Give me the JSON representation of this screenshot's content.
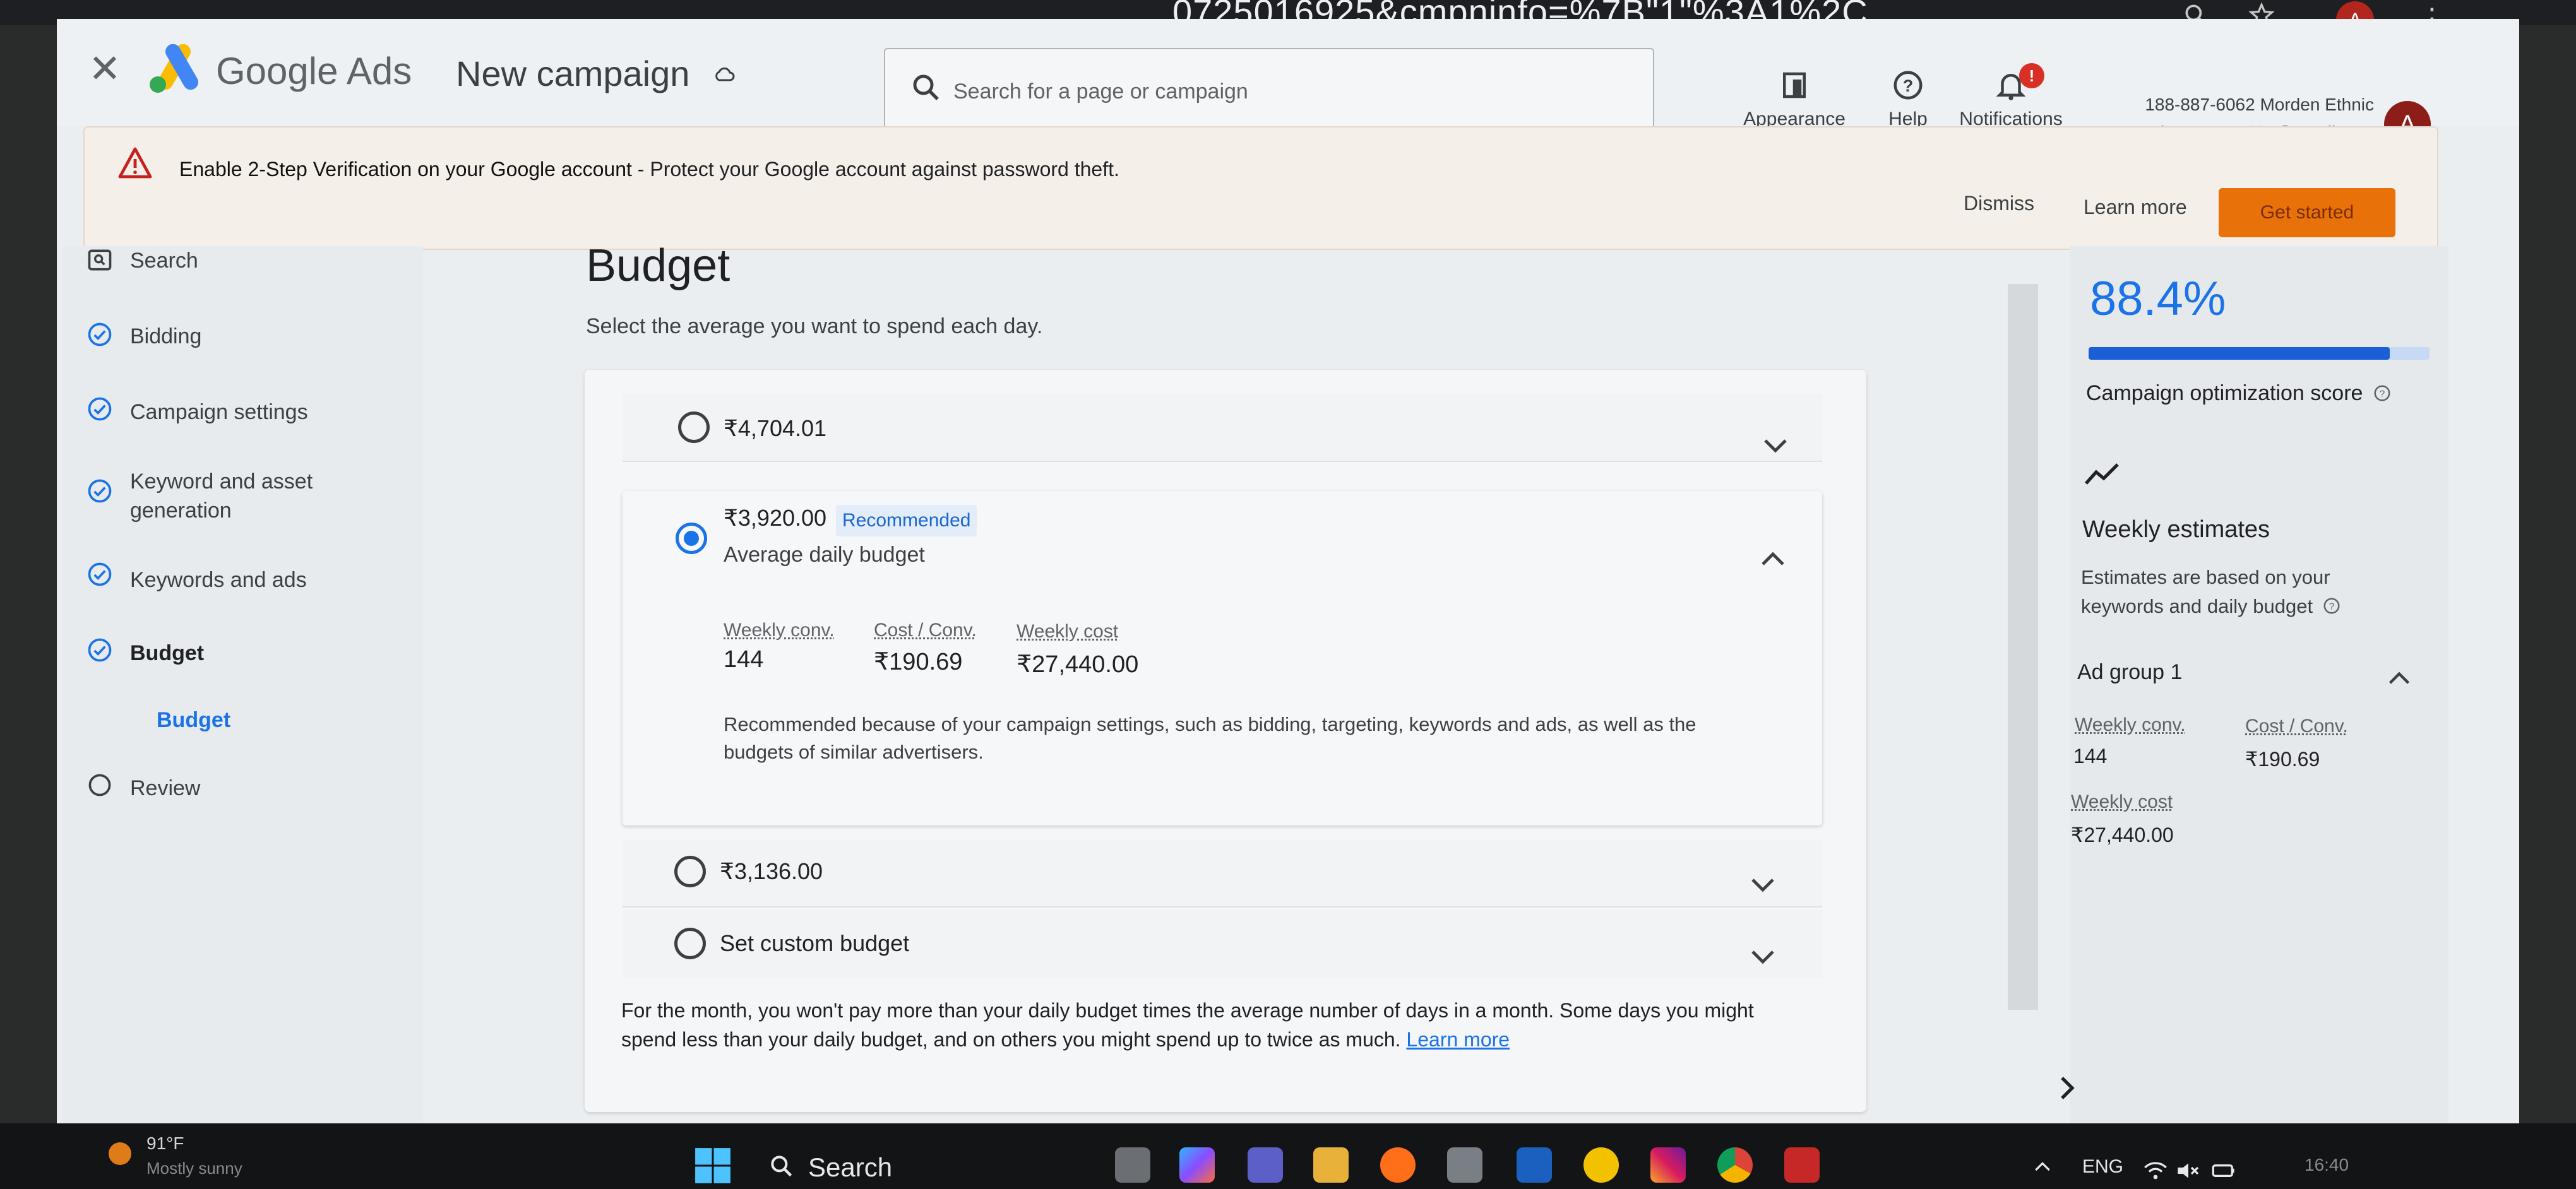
{
  "browser": {
    "url_fragment": "…0725016925&cmpninfo=%7B\"1\"%3A1%2C…",
    "profile_initial": "A"
  },
  "header": {
    "product": "Google Ads",
    "campaign_title": "New campaign",
    "search_placeholder": "Search for a page or campaign",
    "appearance_label": "Appearance",
    "help_label": "Help",
    "notifications_label": "Notifications",
    "notifications_badge": "!",
    "account_line": "188-887-6062 Morden Ethnic",
    "account_email": "aasthaparmar1801@gmail.com",
    "avatar_initial": "A"
  },
  "banner": {
    "title": "Enable 2-Step Verification on your Google account",
    "text": " - Protect your Google account against password theft.",
    "dismiss": "Dismiss",
    "learn_more": "Learn more",
    "get_started": "Get started"
  },
  "sidebar": {
    "items": [
      {
        "label": "Search"
      },
      {
        "label": "Bidding"
      },
      {
        "label": "Campaign settings"
      },
      {
        "label": "Keyword and asset",
        "label2": "generation"
      },
      {
        "label": "Keywords and ads"
      },
      {
        "label": "Budget"
      },
      {
        "label": "Budget"
      },
      {
        "label": "Review"
      }
    ]
  },
  "main": {
    "title": "Budget",
    "subtitle": "Select the average you want to spend each day.",
    "options": [
      {
        "amount": "₹4,704.01",
        "selected": false
      },
      {
        "amount": "₹3,920.00",
        "selected": true,
        "badge": "Recommended",
        "caption": "Average daily budget"
      },
      {
        "amount": "₹3,136.00",
        "selected": false
      },
      {
        "amount": "Set custom budget",
        "selected": false
      }
    ],
    "metrics": [
      {
        "label": "Weekly conv.",
        "value": "144"
      },
      {
        "label": "Cost / Conv.",
        "value": "₹190.69"
      },
      {
        "label": "Weekly cost",
        "value": "₹27,440.00"
      }
    ],
    "recommendation_note": "Recommended because of your campaign settings, such as bidding, targeting, keywords and ads, as well as the budgets of similar advertisers.",
    "monthly_note": "For the month, you won't pay more than your daily budget times the average number of days in a month. Some days you might spend less than your daily budget, and on others you might spend up to twice as much.",
    "monthly_link": "Learn more"
  },
  "right_panel": {
    "score": "88.4%",
    "score_fraction": 0.884,
    "score_label": "Campaign optimization score",
    "weekly_title": "Weekly estimates",
    "weekly_sub": "Estimates are based on your keywords and daily budget",
    "ad_group": "Ad group 1",
    "metrics": [
      {
        "label": "Weekly conv.",
        "value": "144"
      },
      {
        "label": "Cost / Conv.",
        "value": "₹190.69"
      },
      {
        "label": "Weekly cost",
        "value": "₹27,440.00"
      }
    ]
  },
  "taskbar": {
    "weather_temp": "91°F",
    "weather_desc": "Mostly sunny",
    "search": "Search",
    "language": "ENG",
    "time": "16:40"
  },
  "colors": {
    "accent": "#1a73e8",
    "warning": "#e8710a",
    "danger": "#d93025"
  }
}
